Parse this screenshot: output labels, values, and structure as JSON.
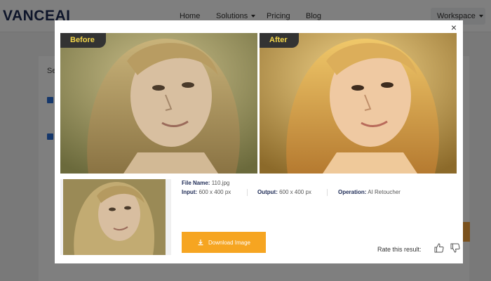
{
  "nav": {
    "logo": "VANCE",
    "logo_ai": "AI",
    "items": [
      {
        "label": "Home"
      },
      {
        "label": "Solutions"
      },
      {
        "label": "Pricing"
      },
      {
        "label": "Blog"
      }
    ],
    "workspace": "Workspace"
  },
  "background": {
    "section_label": "Se"
  },
  "modal": {
    "before_label": "Before",
    "after_label": "After",
    "file_name_label": "File Name:",
    "file_name_value": "110.jpg",
    "input_label": "Input:",
    "input_value": "600 x 400 px",
    "output_label": "Output:",
    "output_value": "600 x 400 px",
    "operation_label": "Operation:",
    "operation_value": "AI Retoucher",
    "download_label": "Download Image",
    "rate_label": "Rate this result:",
    "close_icon": "×"
  },
  "icons": [
    "close-icon",
    "download-icon",
    "thumbs-up-icon",
    "thumbs-down-icon",
    "caret-down-icon"
  ],
  "colors": {
    "accent_orange": "#f6a521",
    "tag_background": "#333333",
    "tag_text": "#f3d64a",
    "brand_navy": "#1d2a55"
  }
}
